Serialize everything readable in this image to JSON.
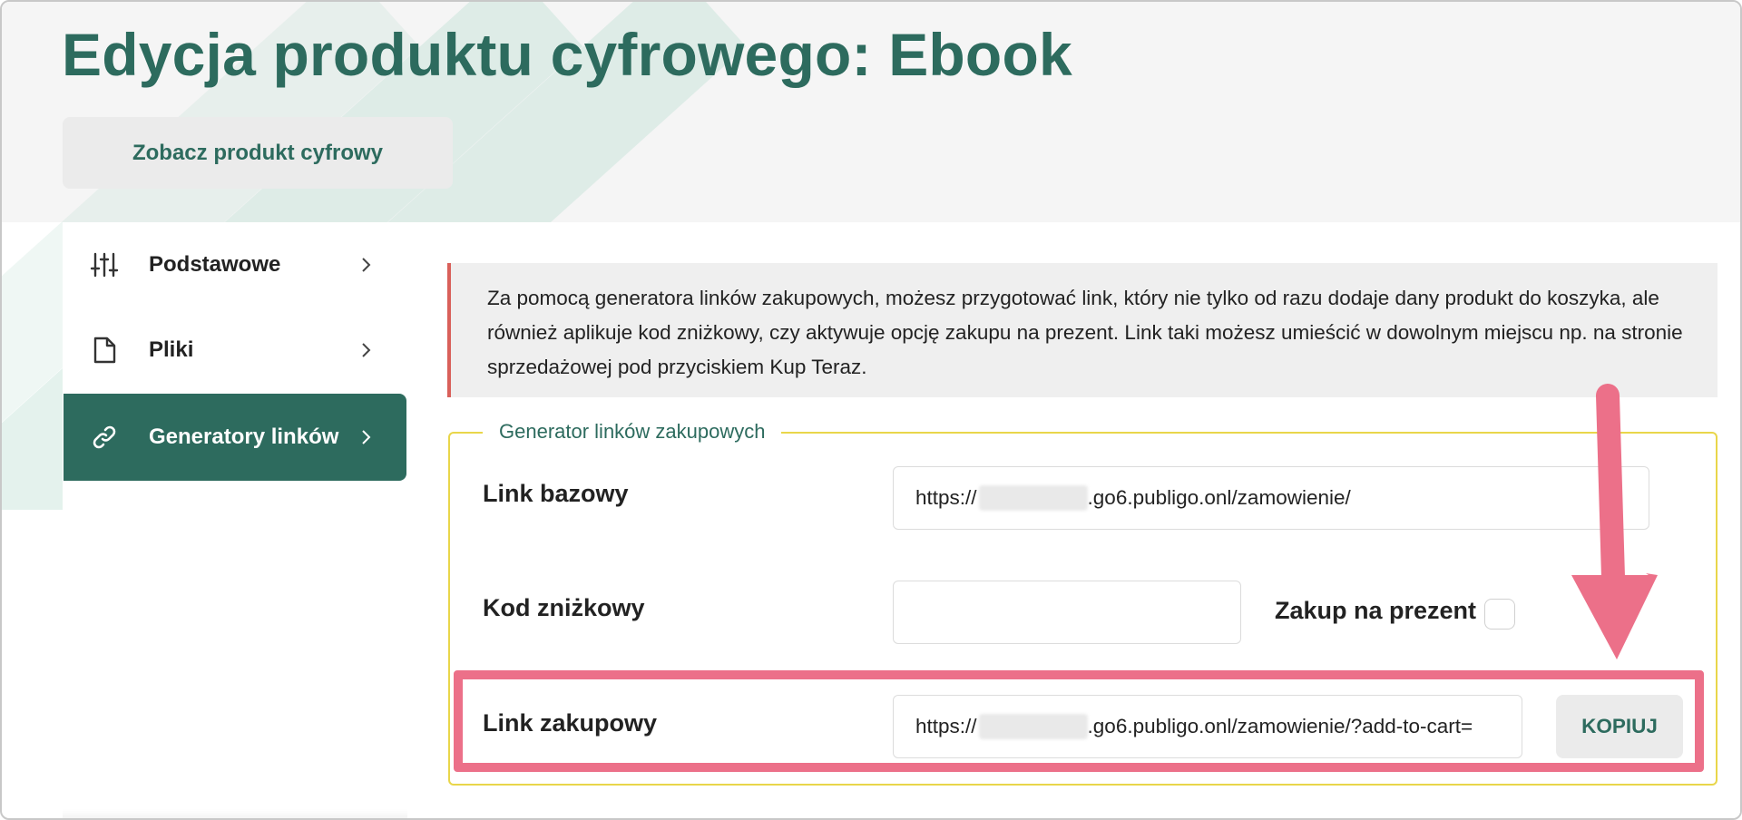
{
  "page": {
    "title": "Edycja produktu cyfrowego: Ebook",
    "view_button": "Zobacz produkt cyfrowy"
  },
  "sidebar": {
    "items": [
      {
        "label": "Podstawowe",
        "icon": "sliders-icon",
        "active": false
      },
      {
        "label": "Pliki",
        "icon": "file-icon",
        "active": false
      },
      {
        "label": "Generatory linków",
        "icon": "link-icon",
        "active": true
      }
    ]
  },
  "info": {
    "text": "Za pomocą generatora linków zakupowych, możesz przygotować link, który nie tylko od razu dodaje dany produkt do koszyka, ale również aplikuje kod zniżkowy, czy aktywuje opcję zakupu na prezent. Link taki możesz umieścić w dowolnym miejscu np. na stronie sprzedażowej pod przyciskiem Kup Teraz."
  },
  "generator": {
    "legend": "Generator linków zakupowych",
    "base_link": {
      "label": "Link bazowy",
      "value_prefix": "https://",
      "value_suffix": ".go6.publigo.onl/zamowienie/"
    },
    "discount": {
      "label": "Kod zniżkowy",
      "value": ""
    },
    "gift": {
      "label": "Zakup na prezent",
      "checked": false
    },
    "purchase_link": {
      "label": "Link zakupowy",
      "value_prefix": "https://",
      "value_suffix": ".go6.publigo.onl/zamowienie/?add-to-cart=",
      "copy_label": "KOPIUJ"
    }
  },
  "colors": {
    "brand": "#2d6b5e",
    "highlight": "#ec7089",
    "info_border": "#d9605a",
    "fieldset_border": "#e9d64a"
  }
}
